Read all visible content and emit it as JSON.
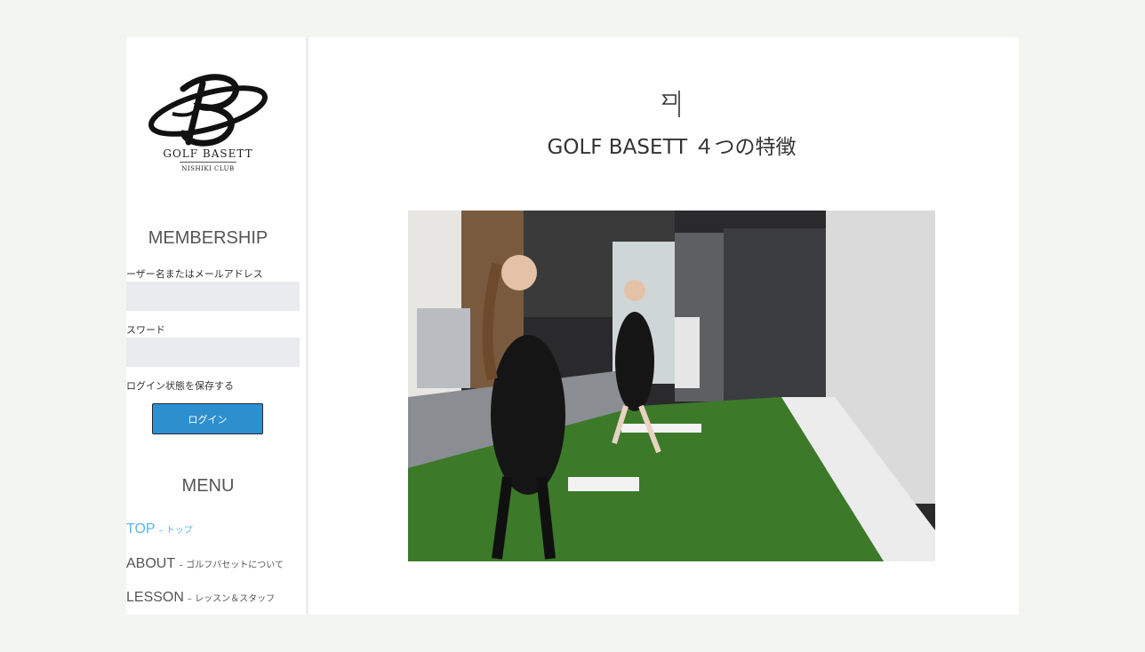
{
  "brand": {
    "name": "GOLF BASETT",
    "sub": "NISHIKI CLUB"
  },
  "membership": {
    "title": "MEMBERSHIP",
    "username_label": "ユーザー名またはメールアドレス",
    "password_label": "パスワード",
    "remember_label": "ログイン状態を保存する",
    "login_button": "ログイン"
  },
  "menu": {
    "title": "MENU",
    "items": [
      {
        "label": "TOP",
        "sub": "– トップ",
        "active": true
      },
      {
        "label": "ABOUT",
        "sub": "– ゴルフバセットについて",
        "active": false
      },
      {
        "label": "LESSON",
        "sub": "– レッスン＆スタッフ",
        "active": false
      }
    ]
  },
  "main": {
    "heading": "GOLF BASETT ４つの特徴",
    "icon": "flag-icon"
  },
  "colors": {
    "accent": "#2e8fcf",
    "active_link": "#5bb3e6",
    "input_bg": "#e9ebef",
    "turf": "#3c7a2a"
  }
}
